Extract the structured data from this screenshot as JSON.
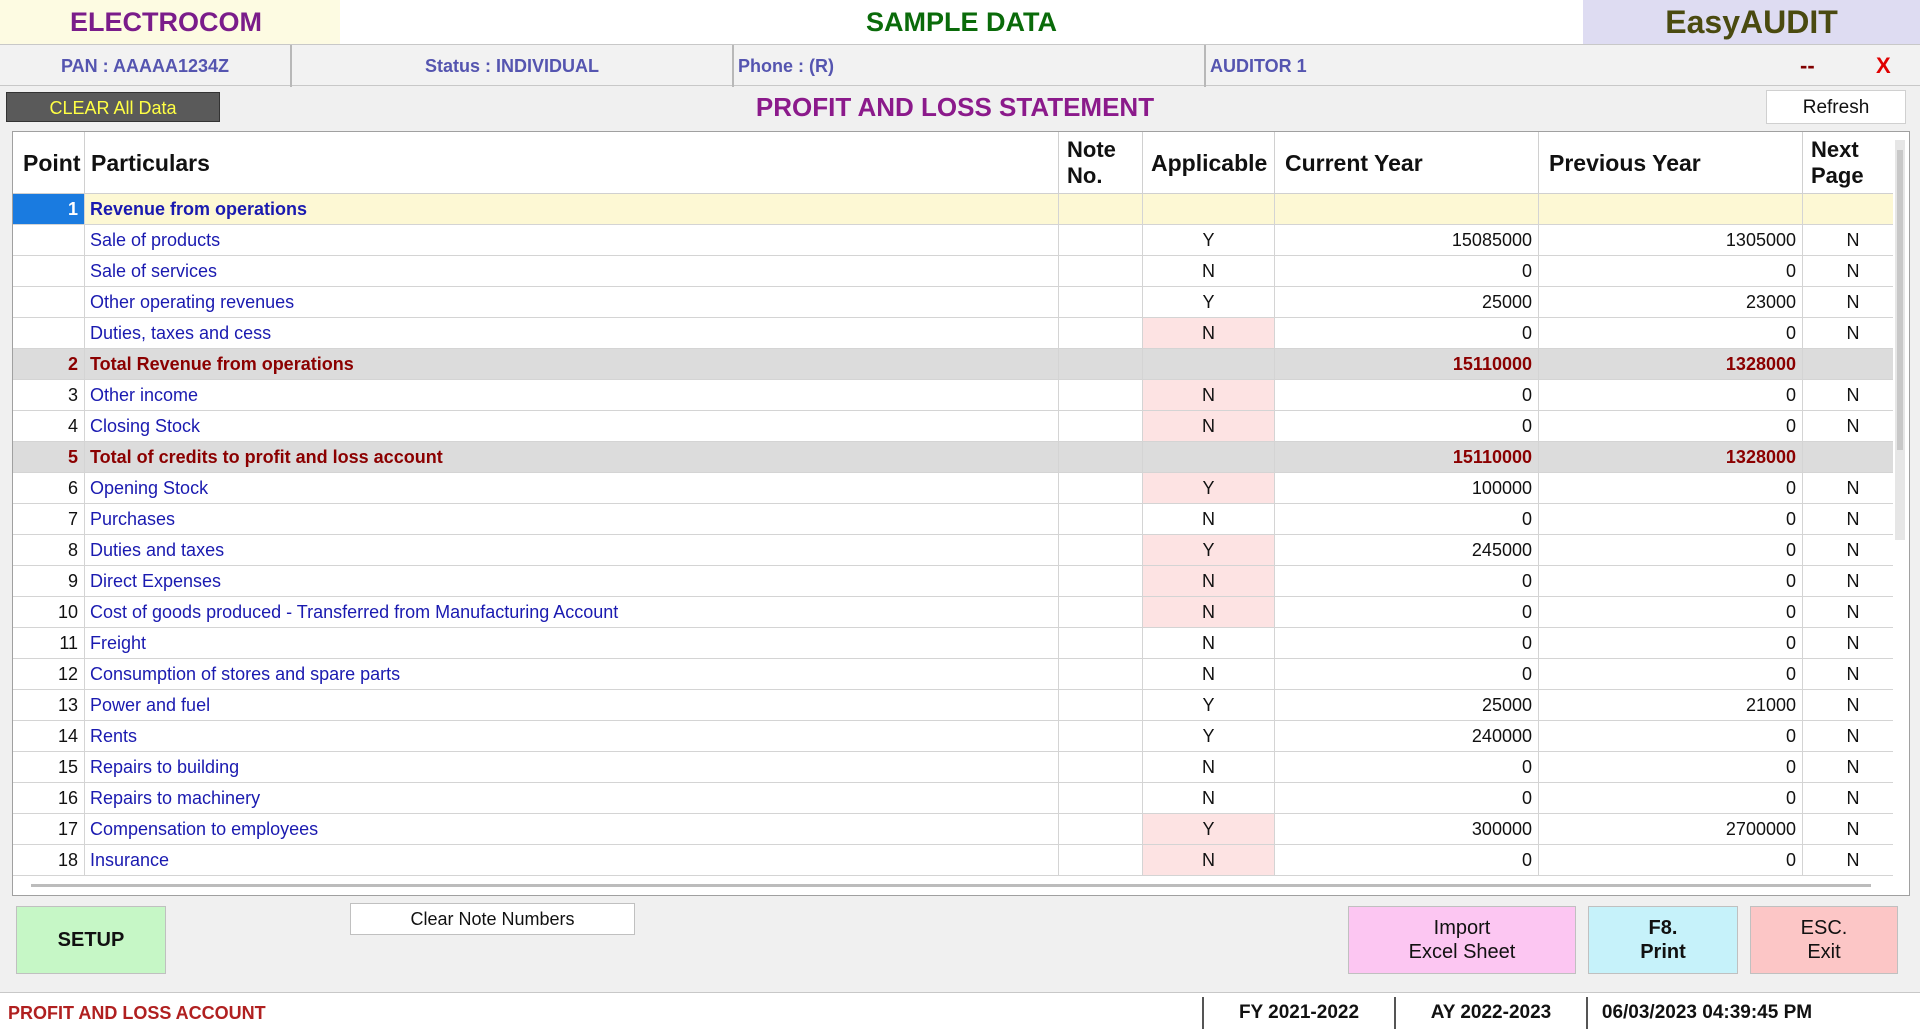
{
  "titlebar": {
    "company": "ELECTROCOM",
    "sample": "SAMPLE DATA",
    "app": "EasyAUDIT"
  },
  "infobar": {
    "pan": "PAN  :  AAAAA1234Z",
    "status": "Status  :  INDIVIDUAL",
    "phone": "Phone  : (R)",
    "auditor": "AUDITOR 1",
    "minimize": "--",
    "close": "X"
  },
  "toolbar": {
    "clear_all": "CLEAR All Data",
    "title": "PROFIT AND LOSS STATEMENT",
    "refresh": "Refresh"
  },
  "grid": {
    "headers": {
      "point": "Point",
      "particulars": "Particulars",
      "note_1": "Note",
      "note_2": "No.",
      "applicable": "Applicable",
      "current": "Current Year",
      "previous": "Previous Year",
      "next_1": "Next",
      "next_2": "Page"
    },
    "rows": [
      {
        "point": "1",
        "particulars": "Revenue from operations",
        "note": "",
        "applicable": "",
        "current": "",
        "previous": "",
        "next": "",
        "kind": "header",
        "pink": false
      },
      {
        "point": "",
        "particulars": "Sale of products",
        "note": "",
        "applicable": "Y",
        "current": "15085000",
        "previous": "1305000",
        "next": "N",
        "kind": "normal",
        "pink": false
      },
      {
        "point": "",
        "particulars": "Sale of services",
        "note": "",
        "applicable": "N",
        "current": "0",
        "previous": "0",
        "next": "N",
        "kind": "normal",
        "pink": false
      },
      {
        "point": "",
        "particulars": "Other operating revenues",
        "note": "",
        "applicable": "Y",
        "current": "25000",
        "previous": "23000",
        "next": "N",
        "kind": "normal",
        "pink": false
      },
      {
        "point": "",
        "particulars": "Duties, taxes and cess",
        "note": "",
        "applicable": "N",
        "current": "0",
        "previous": "0",
        "next": "N",
        "kind": "normal",
        "pink": true
      },
      {
        "point": "2",
        "particulars": "Total Revenue from operations",
        "note": "",
        "applicable": "",
        "current": "15110000",
        "previous": "1328000",
        "next": "",
        "kind": "total",
        "pink": false
      },
      {
        "point": "3",
        "particulars": "Other income",
        "note": "",
        "applicable": "N",
        "current": "0",
        "previous": "0",
        "next": "N",
        "kind": "normal",
        "pink": true
      },
      {
        "point": "4",
        "particulars": "Closing Stock",
        "note": "",
        "applicable": "N",
        "current": "0",
        "previous": "0",
        "next": "N",
        "kind": "normal",
        "pink": true
      },
      {
        "point": "5",
        "particulars": "Total of credits to profit and loss account",
        "note": "",
        "applicable": "",
        "current": "15110000",
        "previous": "1328000",
        "next": "",
        "kind": "total",
        "pink": false
      },
      {
        "point": "6",
        "particulars": "Opening Stock",
        "note": "",
        "applicable": "Y",
        "current": "100000",
        "previous": "0",
        "next": "N",
        "kind": "normal",
        "pink": true
      },
      {
        "point": "7",
        "particulars": "Purchases",
        "note": "",
        "applicable": "N",
        "current": "0",
        "previous": "0",
        "next": "N",
        "kind": "normal",
        "pink": false
      },
      {
        "point": "8",
        "particulars": "Duties and taxes",
        "note": "",
        "applicable": "Y",
        "current": "245000",
        "previous": "0",
        "next": "N",
        "kind": "normal",
        "pink": true
      },
      {
        "point": "9",
        "particulars": "Direct Expenses",
        "note": "",
        "applicable": "N",
        "current": "0",
        "previous": "0",
        "next": "N",
        "kind": "normal",
        "pink": true
      },
      {
        "point": "10",
        "particulars": "Cost of goods produced - Transferred from Manufacturing Account",
        "note": "",
        "applicable": "N",
        "current": "0",
        "previous": "0",
        "next": "N",
        "kind": "normal",
        "pink": true
      },
      {
        "point": "11",
        "particulars": "Freight",
        "note": "",
        "applicable": "N",
        "current": "0",
        "previous": "0",
        "next": "N",
        "kind": "normal",
        "pink": false
      },
      {
        "point": "12",
        "particulars": "Consumption of stores and spare parts",
        "note": "",
        "applicable": "N",
        "current": "0",
        "previous": "0",
        "next": "N",
        "kind": "normal",
        "pink": false
      },
      {
        "point": "13",
        "particulars": "Power and fuel",
        "note": "",
        "applicable": "Y",
        "current": "25000",
        "previous": "21000",
        "next": "N",
        "kind": "normal",
        "pink": false
      },
      {
        "point": "14",
        "particulars": "Rents",
        "note": "",
        "applicable": "Y",
        "current": "240000",
        "previous": "0",
        "next": "N",
        "kind": "normal",
        "pink": false
      },
      {
        "point": "15",
        "particulars": "Repairs to building",
        "note": "",
        "applicable": "N",
        "current": "0",
        "previous": "0",
        "next": "N",
        "kind": "normal",
        "pink": false
      },
      {
        "point": "16",
        "particulars": "Repairs to machinery",
        "note": "",
        "applicable": "N",
        "current": "0",
        "previous": "0",
        "next": "N",
        "kind": "normal",
        "pink": false
      },
      {
        "point": "17",
        "particulars": "Compensation to employees",
        "note": "",
        "applicable": "Y",
        "current": "300000",
        "previous": "2700000",
        "next": "N",
        "kind": "normal",
        "pink": true
      },
      {
        "point": "18",
        "particulars": "Insurance",
        "note": "",
        "applicable": "N",
        "current": "0",
        "previous": "0",
        "next": "N",
        "kind": "normal",
        "pink": true
      }
    ]
  },
  "buttons": {
    "setup": "SETUP",
    "clear_notes": "Clear Note Numbers",
    "import_1": "Import",
    "import_2": "Excel Sheet",
    "print_1": "F8.",
    "print_2": "Print",
    "exit_1": "ESC.",
    "exit_2": "Exit"
  },
  "statusbar": {
    "section": "PROFIT AND LOSS ACCOUNT",
    "fy": "FY 2021-2022",
    "ay": "AY 2022-2023",
    "datetime": "06/03/2023 04:39:45 PM"
  }
}
